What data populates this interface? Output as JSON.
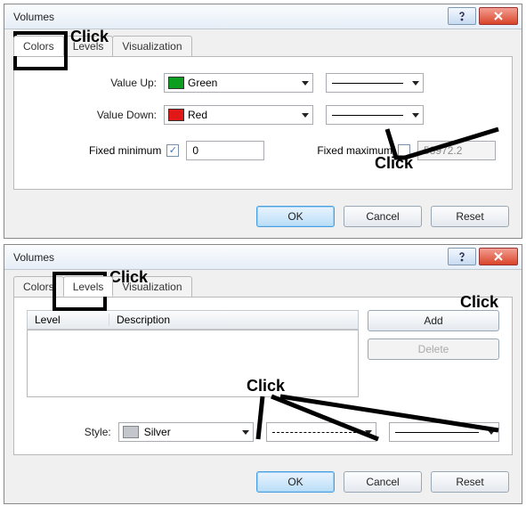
{
  "dialog1": {
    "title": "Volumes",
    "tabs": [
      "Colors",
      "Levels",
      "Visualization"
    ],
    "activeTab": 0,
    "valueUp": {
      "label": "Value Up:",
      "color": "Green",
      "swatch": "#0b9e1f"
    },
    "valueDown": {
      "label": "Value Down:",
      "color": "Red",
      "swatch": "#e21717"
    },
    "fixedMin": {
      "label": "Fixed minimum",
      "checked": true,
      "value": "0"
    },
    "fixedMax": {
      "label": "Fixed maximum",
      "checked": false,
      "value": "58972.2"
    },
    "buttons": {
      "ok": "OK",
      "cancel": "Cancel",
      "reset": "Reset"
    }
  },
  "dialog2": {
    "title": "Volumes",
    "tabs": [
      "Colors",
      "Levels",
      "Visualization"
    ],
    "activeTab": 1,
    "listHeaders": {
      "level": "Level",
      "desc": "Description"
    },
    "sideButtons": {
      "add": "Add",
      "del": "Delete"
    },
    "style": {
      "label": "Style:",
      "color": "Silver"
    },
    "buttons": {
      "ok": "OK",
      "cancel": "Cancel",
      "reset": "Reset"
    }
  },
  "annotations": {
    "click": "Click"
  }
}
